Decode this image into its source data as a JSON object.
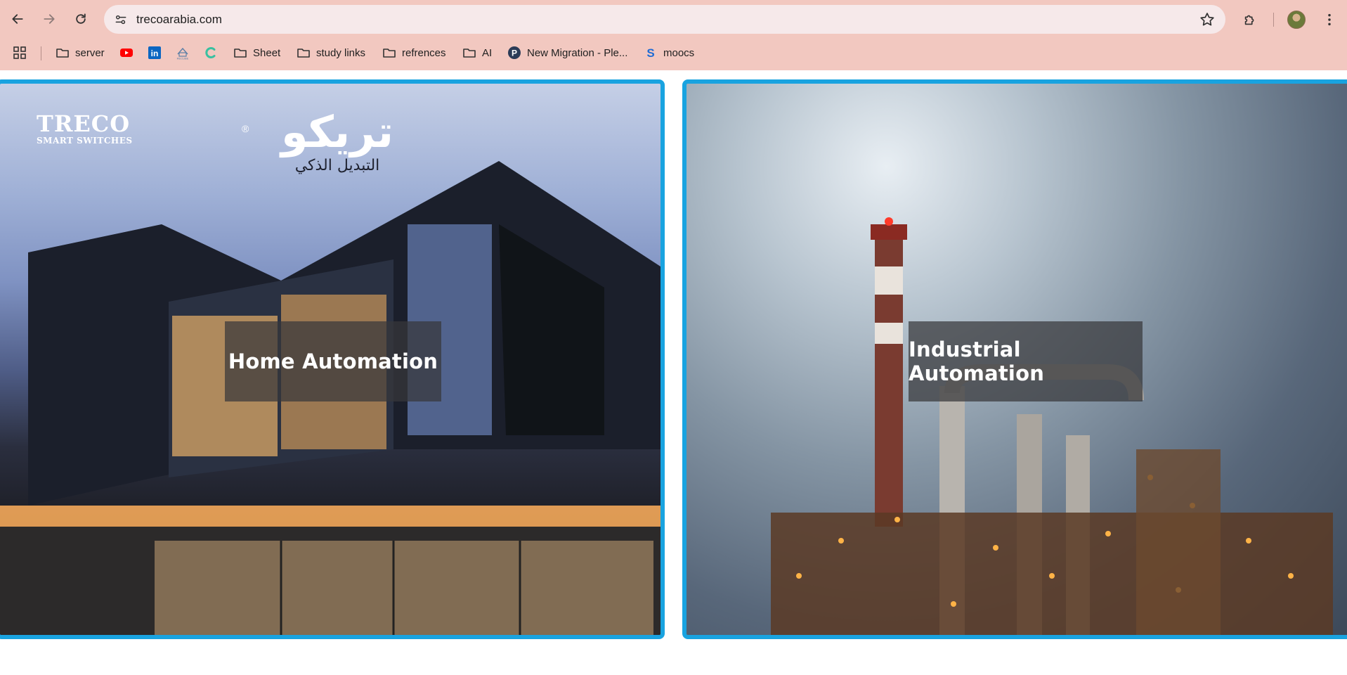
{
  "browser": {
    "url": "trecoarabia.com",
    "bookmarks": [
      {
        "label": "server",
        "icon": "folder-icon"
      },
      {
        "label": "",
        "icon": "youtube-icon"
      },
      {
        "label": "",
        "icon": "linkedin-icon"
      },
      {
        "label": "",
        "icon": "recube-icon"
      },
      {
        "label": "",
        "icon": "c-icon"
      },
      {
        "label": "Sheet",
        "icon": "folder-icon"
      },
      {
        "label": "study links",
        "icon": "folder-icon"
      },
      {
        "label": "refrences",
        "icon": "folder-icon"
      },
      {
        "label": "AI",
        "icon": "folder-icon"
      },
      {
        "label": "New Migration - Ple...",
        "icon": "pleaseticket-icon"
      },
      {
        "label": "moocs",
        "icon": "s-icon"
      }
    ],
    "accent_color": "#f2c8c0"
  },
  "page": {
    "cards": [
      {
        "title": "Home Automation"
      },
      {
        "title": "Industrial Automation"
      }
    ],
    "logo": {
      "name": "TRECO",
      "tagline": "SMART SWITCHES",
      "arabic_name": "تريكو",
      "arabic_tagline": "التبديل الذكي",
      "registered": "®"
    },
    "card_border_color": "#19a3e0"
  }
}
